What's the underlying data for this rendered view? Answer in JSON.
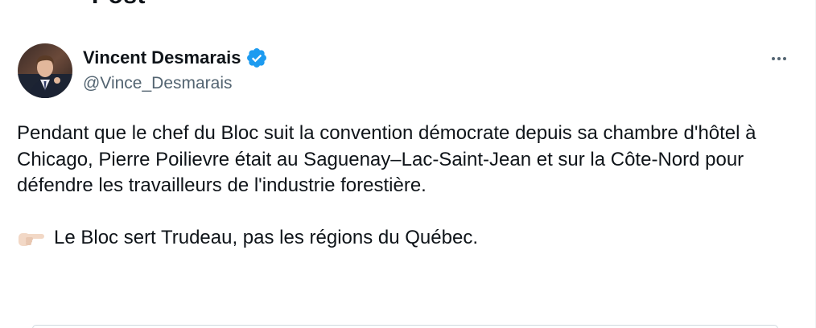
{
  "page_header": {
    "partial_title": "Post"
  },
  "tweet": {
    "author": {
      "name": "Vincent Desmarais",
      "handle": "@Vince_Desmarais",
      "verified": true,
      "verified_color": "#1d9bf0"
    },
    "body_paragraph": "Pendant que le chef du Bloc suit la convention démocrate depuis sa chambre d'hôtel à Chicago, Pierre Poilievre était au Saguenay–Lac-Saint-Jean et sur la Côte-Nord pour défendre les travailleurs de l'industrie forestière.",
    "pointing_line": "Le Bloc sert Trudeau, pas les régions du Québec.",
    "emoji": "pointing-right-hand-icon"
  },
  "colors": {
    "text_primary": "#0f1419",
    "text_secondary": "#536471",
    "accent_blue": "#1d9bf0",
    "border": "#cfd9de"
  }
}
